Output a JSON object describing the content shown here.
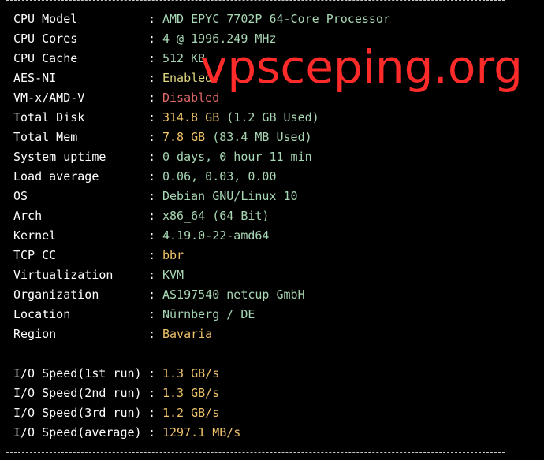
{
  "separator_text": "----------------------------------------------------------------------",
  "system_info": [
    {
      "label": "CPU Model",
      "colon": ":",
      "value": "AMD EPYC 7702P 64-Core Processor",
      "color": "#a7d6b3"
    },
    {
      "label": "CPU Cores",
      "colon": ":",
      "value": "4 @ 1996.249 MHz",
      "color": "#a7d6b3"
    },
    {
      "label": "CPU Cache",
      "colon": ":",
      "value": "512 KB",
      "color": "#a7d6b3"
    },
    {
      "label": "AES-NI",
      "colon": ":",
      "value": "Enabled",
      "color": "#e1d882"
    },
    {
      "label": "VM-x/AMD-V",
      "colon": ":",
      "value": "Disabled",
      "color": "#e06868"
    },
    {
      "label": "Total Disk",
      "colon": ":",
      "value": "314.8 GB",
      "extra": "(1.2 GB Used)",
      "color": "#f0c36a",
      "extra_color": "#a7d6b3"
    },
    {
      "label": "Total Mem",
      "colon": ":",
      "value": "7.8 GB",
      "extra": "(83.4 MB Used)",
      "color": "#f0c36a",
      "extra_color": "#a7d6b3"
    },
    {
      "label": "System uptime",
      "colon": ":",
      "value": "0 days, 0 hour 11 min",
      "color": "#a7d6b3"
    },
    {
      "label": "Load average",
      "colon": ":",
      "value": "0.06, 0.03, 0.00",
      "color": "#a7d6b3"
    },
    {
      "label": "OS",
      "colon": ":",
      "value": "Debian GNU/Linux 10",
      "color": "#a7d6b3"
    },
    {
      "label": "Arch",
      "colon": ":",
      "value": "x86_64 (64 Bit)",
      "color": "#a7d6b3"
    },
    {
      "label": "Kernel",
      "colon": ":",
      "value": "4.19.0-22-amd64",
      "color": "#a7d6b3"
    },
    {
      "label": "TCP CC",
      "colon": ":",
      "value": "bbr",
      "color": "#f0c36a"
    },
    {
      "label": "Virtualization",
      "colon": ":",
      "value": "KVM",
      "color": "#a7d6b3"
    },
    {
      "label": "Organization",
      "colon": ":",
      "value": "AS197540 netcup GmbH",
      "color": "#a7d6b3"
    },
    {
      "label": "Location",
      "colon": ":",
      "value": "Nürnberg / DE",
      "color": "#a7d6b3"
    },
    {
      "label": "Region",
      "colon": ":",
      "value": "Bavaria",
      "color": "#f0c36a"
    }
  ],
  "io_speed": [
    {
      "label": "I/O Speed(1st run)",
      "colon": ":",
      "value": "1.3 GB/s",
      "color": "#f0c36a"
    },
    {
      "label": "I/O Speed(2nd run)",
      "colon": ":",
      "value": "1.3 GB/s",
      "color": "#f0c36a"
    },
    {
      "label": "I/O Speed(3rd run)",
      "colon": ":",
      "value": "1.2 GB/s",
      "color": "#f0c36a"
    },
    {
      "label": "I/O Speed(average)",
      "colon": ":",
      "value": "1297.1 MB/s",
      "color": "#f0c36a"
    }
  ],
  "watermark": "vpsceping.org",
  "colors": {
    "background": "#000000",
    "label": "#ffffff",
    "value_green": "#a7d6b3",
    "value_yellow": "#f0c36a",
    "value_red": "#e06868",
    "value_olive": "#e1d882",
    "watermark": "#ff2a2a"
  }
}
